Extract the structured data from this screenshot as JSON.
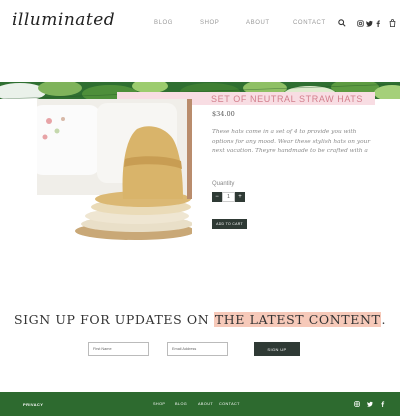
{
  "header": {
    "logo": "illuminated",
    "nav": [
      "BLOG",
      "SHOP",
      "ABOUT",
      "CONTACT"
    ],
    "icons": [
      "search-icon",
      "instagram-icon",
      "twitter-icon",
      "facebook-icon",
      "cart-icon"
    ]
  },
  "product": {
    "title": "SET OF NEUTRAL STRAW HATS",
    "price": "$34.00",
    "description": "These hats come in a set of 4 to provide you with options for any mood. Wear these stylish hats on your next vacation. Theyre handmade to be crafted with a",
    "quantity_label": "Quantity",
    "quantity_value": "1",
    "minus": "−",
    "plus": "+",
    "add_to_cart": "ADD TO CART"
  },
  "signup": {
    "prefix": "SIGN UP FOR UPDATES ON ",
    "highlight": "THE LATEST CONTENT",
    "suffix": ".",
    "first_name_placeholder": "First Name",
    "email_placeholder": "Email Address",
    "button": "SIGN UP"
  },
  "footer": {
    "privacy": "PRIVACY",
    "links": [
      "SHOP",
      "BLOG",
      "ABOUT",
      "CONTACT"
    ],
    "icons": [
      "instagram-icon",
      "twitter-icon",
      "facebook-icon"
    ]
  },
  "colors": {
    "brand_green": "#2d6a2f",
    "title_pink": "#d27e8c",
    "highlight_peach": "#f6c9b9",
    "button_dark": "#2f3a35"
  }
}
